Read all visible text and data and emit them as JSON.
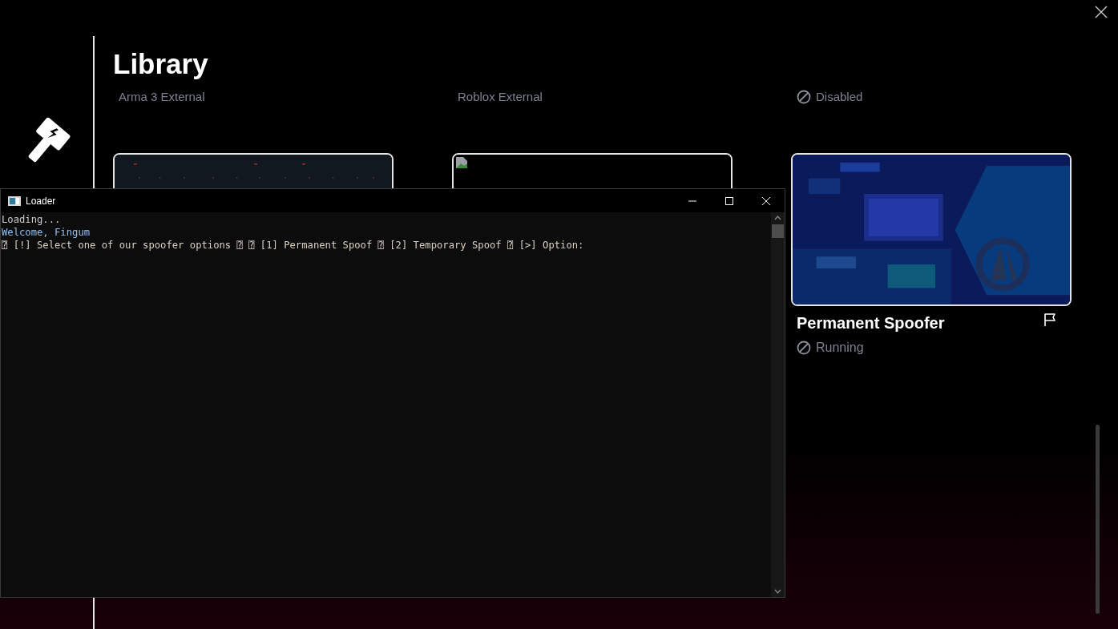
{
  "library": {
    "title": "Library",
    "columns": [
      {
        "subtitle": "Arma 3 External",
        "disabled": false,
        "card": {
          "kind": "dark"
        }
      },
      {
        "subtitle": "Roblox External",
        "disabled": false,
        "card": {
          "kind": "broken_image"
        }
      },
      {
        "subtitle": "Disabled",
        "disabled": true,
        "card": {
          "kind": "picture",
          "title": "Permanent Spoofer",
          "status": "Running"
        }
      }
    ]
  },
  "console": {
    "title": "Loader",
    "lines": [
      {
        "text": "Loading...",
        "color": "#cccccc"
      },
      {
        "text": "Welcome, Fingum",
        "color": "#8fc1ef"
      },
      {
        "text": "⍰ [!] Select one of our spoofer options ⍰ ⍰ [1] Permanent Spoof ⍰ [2] Temporary Spoof ⍰ [>] Option:",
        "color": "#d7d2c4"
      }
    ]
  }
}
